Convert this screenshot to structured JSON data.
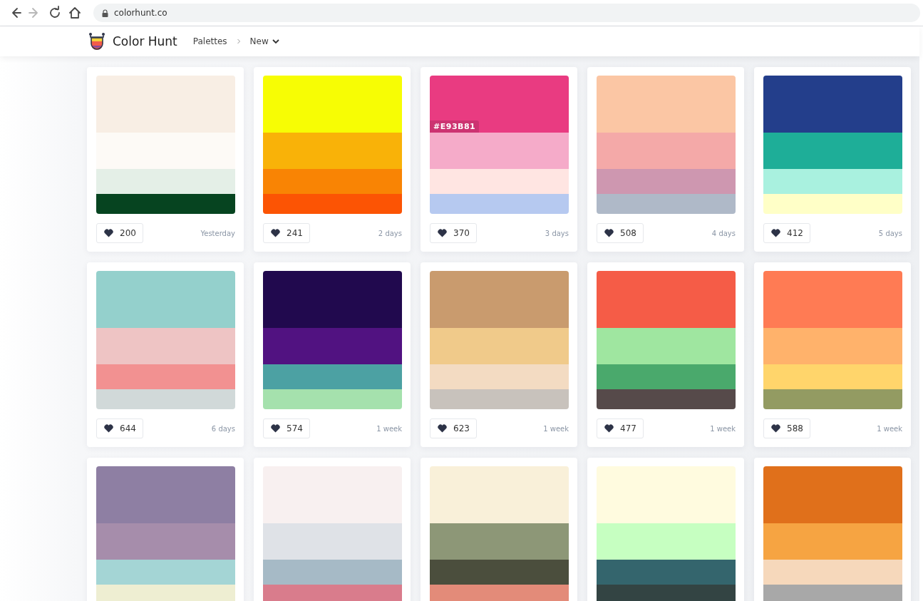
{
  "browser": {
    "nav": [
      {
        "kind": "back",
        "disabled": false
      },
      {
        "kind": "forward",
        "disabled": true
      },
      {
        "kind": "reload",
        "disabled": false
      },
      {
        "kind": "home",
        "disabled": false
      }
    ],
    "url": "colorhunt.co"
  },
  "header": {
    "brand": "Color Hunt",
    "breadcrumb": "Palettes",
    "current": "New"
  },
  "palettes": [
    {
      "colors": [
        {
          "color": "#f8eee4"
        },
        {
          "color": "#fdfaf6"
        },
        {
          "color": "#e4efe7"
        },
        {
          "color": "#064420"
        }
      ],
      "likes": "200",
      "age": "Yesterday"
    },
    {
      "colors": [
        {
          "color": "#f7fd04"
        },
        {
          "color": "#f9b208"
        },
        {
          "color": "#f98404"
        },
        {
          "color": "#fc5404"
        }
      ],
      "likes": "241",
      "age": "2 days"
    },
    {
      "colors": [
        {
          "color": "#e93b81",
          "label": "#E93B81"
        },
        {
          "color": "#f5abc9"
        },
        {
          "color": "#ffe5e2"
        },
        {
          "color": "#b6c9f0"
        }
      ],
      "likes": "370",
      "age": "3 days"
    },
    {
      "colors": [
        {
          "color": "#fbc6a4"
        },
        {
          "color": "#f4a9a8"
        },
        {
          "color": "#ce97b0"
        },
        {
          "color": "#afb9c8"
        }
      ],
      "likes": "508",
      "age": "4 days"
    },
    {
      "colors": [
        {
          "color": "#233e8b"
        },
        {
          "color": "#1eae98"
        },
        {
          "color": "#a9f1df"
        },
        {
          "color": "#ffffc7"
        }
      ],
      "likes": "412",
      "age": "5 days"
    },
    {
      "colors": [
        {
          "color": "#94d0cc"
        },
        {
          "color": "#eec4c4"
        },
        {
          "color": "#f29191"
        },
        {
          "color": "#d1d9d9"
        }
      ],
      "likes": "644",
      "age": "6 days"
    },
    {
      "colors": [
        {
          "color": "#21094e"
        },
        {
          "color": "#511281"
        },
        {
          "color": "#4ca1a3"
        },
        {
          "color": "#a5e1ad"
        }
      ],
      "likes": "574",
      "age": "1 week"
    },
    {
      "colors": [
        {
          "color": "#c99b6e"
        },
        {
          "color": "#f0ca8a"
        },
        {
          "color": "#f3dbc2"
        },
        {
          "color": "#c8c2bc"
        }
      ],
      "likes": "623",
      "age": "1 week"
    },
    {
      "colors": [
        {
          "color": "#f55c47"
        },
        {
          "color": "#9fe6a0"
        },
        {
          "color": "#4aa96c"
        },
        {
          "color": "#564a4a"
        }
      ],
      "likes": "477",
      "age": "1 week"
    },
    {
      "colors": [
        {
          "color": "#ff7b54"
        },
        {
          "color": "#ffb26b"
        },
        {
          "color": "#ffd56b"
        },
        {
          "color": "#939b62"
        }
      ],
      "likes": "588",
      "age": "1 week"
    },
    {
      "colors": [
        {
          "color": "#8e7fa3"
        },
        {
          "color": "#a68dab"
        },
        {
          "color": "#a4d5d5"
        },
        {
          "color": "#eeeed2"
        }
      ]
    },
    {
      "colors": [
        {
          "color": "#f8f0f0"
        },
        {
          "color": "#dfe2e7"
        },
        {
          "color": "#a6bac6"
        },
        {
          "color": "#d97c8c"
        }
      ]
    },
    {
      "colors": [
        {
          "color": "#f9f0d9"
        },
        {
          "color": "#8d9777"
        },
        {
          "color": "#4b4e3d"
        },
        {
          "color": "#e38b79"
        }
      ]
    },
    {
      "colors": [
        {
          "color": "#fffbdf"
        },
        {
          "color": "#c6ffc1"
        },
        {
          "color": "#34656d"
        },
        {
          "color": "#334443"
        }
      ]
    },
    {
      "colors": [
        {
          "color": "#e0701b"
        },
        {
          "color": "#f6a442"
        },
        {
          "color": "#f6d8bb"
        },
        {
          "color": "#a8a8a8"
        }
      ]
    }
  ]
}
